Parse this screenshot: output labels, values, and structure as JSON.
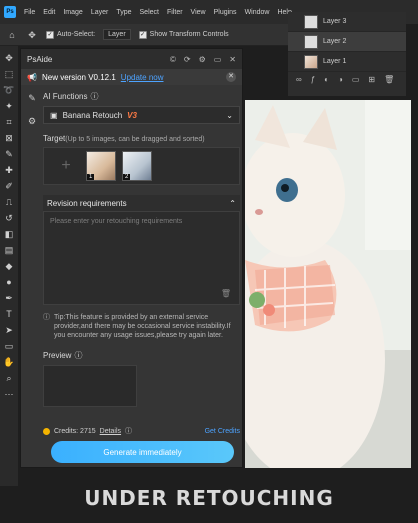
{
  "menubar": {
    "logo": "Ps",
    "items": [
      "File",
      "Edit",
      "Image",
      "Layer",
      "Type",
      "Select",
      "Filter",
      "View",
      "Plugins",
      "Window",
      "Help"
    ]
  },
  "options": {
    "auto_select": "Auto-Select:",
    "layer_select": "Layer",
    "transform": "Show Transform Controls"
  },
  "layers": {
    "items": [
      "Layer 3",
      "Layer 2",
      "Layer 1"
    ]
  },
  "panel": {
    "title": "PsAide",
    "notice": {
      "title": "New version V0.12.1",
      "link": "Update now"
    },
    "ai_functions_label": "AI Functions",
    "ai_function_value": "Banana Retouch",
    "ai_function_badge": "V3",
    "target_label": "Target",
    "target_hint": "(Up to 5 images, can be dragged and sorted)",
    "thumbs": [
      "1",
      "2"
    ],
    "revision_label": "Revision requirements",
    "revision_placeholder": "Please enter your retouching requirements",
    "tip": "Tip:This feature is provided by an external service provider,and there may be occasional service instability.If you encounter any usage issues,please try again later.",
    "preview_label": "Preview",
    "credits_label": "Credits: 2715",
    "details": "Details",
    "get_credits": "Get Credits",
    "generate": "Generate immediately"
  },
  "caption": "UNDER RETOUCHING",
  "colors": {
    "accent": "#4da3ff",
    "generate_start": "#3ab0ff",
    "generate_end": "#5ac8fa",
    "badge": "#ff7a45",
    "coin": "#f4b400"
  }
}
